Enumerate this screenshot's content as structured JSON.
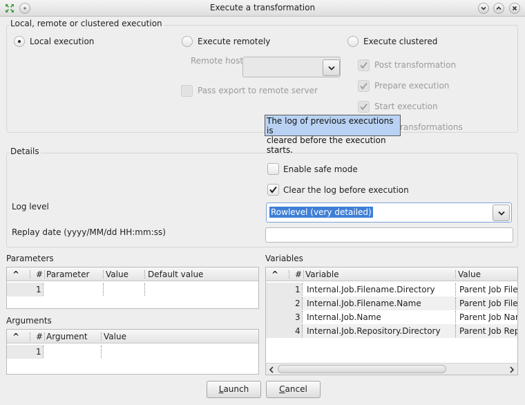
{
  "window": {
    "title": "Execute a transformation"
  },
  "execution_group": {
    "title": "Local, remote or clustered execution",
    "local_label": "Local execution",
    "remote_label": "Execute remotely",
    "clustered_label": "Execute clustered",
    "remote_host_label": "Remote host",
    "remote_host_value": "",
    "pass_export_label": "Pass export to remote server",
    "post_transformation_label": "Post transformation",
    "prepare_execution_label": "Prepare execution",
    "start_execution_label": "Start execution",
    "show_transformations_label_tail": "ransformations",
    "selected": "Local execution"
  },
  "tooltip": {
    "line1": "The log of previous executions is",
    "line2": "cleared before the execution starts."
  },
  "details_group": {
    "title": "Details",
    "safe_mode_label": "Enable safe mode",
    "safe_mode_checked": false,
    "clear_log_label": "Clear the log before execution",
    "clear_log_checked": true,
    "log_level_label": "Log level",
    "log_level_value": "Rowlevel (very detailed)",
    "replay_date_label": "Replay date (yyyy/MM/dd HH:mm:ss)",
    "replay_date_value": ""
  },
  "parameters": {
    "title": "Parameters",
    "sort_glyph": "^",
    "columns": [
      "#",
      "Parameter",
      "Value",
      "Default value"
    ],
    "rows": [
      {
        "num": "1",
        "parameter": "",
        "value": "",
        "default": ""
      }
    ]
  },
  "arguments": {
    "title": "Arguments",
    "sort_glyph": "^",
    "columns": [
      "#",
      "Argument",
      "Value"
    ],
    "rows": [
      {
        "num": "1",
        "argument": "",
        "value": ""
      }
    ]
  },
  "variables": {
    "title": "Variables",
    "sort_glyph": "^",
    "columns": [
      "#",
      "Variable",
      "Value"
    ],
    "rows": [
      {
        "num": "1",
        "variable": "Internal.Job.Filename.Directory",
        "value": "Parent Job File"
      },
      {
        "num": "2",
        "variable": "Internal.Job.Filename.Name",
        "value": "Parent Job File"
      },
      {
        "num": "3",
        "variable": "Internal.Job.Name",
        "value": "Parent Job Nar"
      },
      {
        "num": "4",
        "variable": "Internal.Job.Repository.Directory",
        "value": "Parent Job Rep"
      }
    ]
  },
  "buttons": {
    "launch_mnemonic": "L",
    "launch_rest": "aunch",
    "cancel_mnemonic": "C",
    "cancel_rest": "ancel"
  },
  "icons": {
    "app_icon": "arrows-expand-icon",
    "menu_icon": "window-menu-icon",
    "minimize_icon": "minimize-icon",
    "maximize_icon": "maximize-icon",
    "close_icon": "close-icon"
  }
}
